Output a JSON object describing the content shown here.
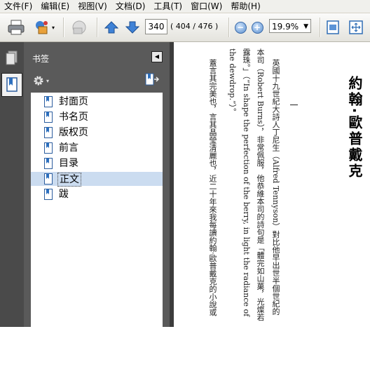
{
  "menu": [
    "文件(F)",
    "编辑(E)",
    "视图(V)",
    "文档(D)",
    "工具(T)",
    "窗口(W)",
    "帮助(H)"
  ],
  "toolbar": {
    "page_number": "340",
    "page_count": "( 404 / 476 )",
    "zoom": "19.9%"
  },
  "panel": {
    "title": "书签",
    "bookmarks": [
      "封面页",
      "书名页",
      "版权页",
      "前言",
      "目录",
      "正文",
      "跋"
    ],
    "selected_index": 5
  },
  "document": {
    "heading": "約翰‧歐普戴克",
    "section_mark": "一",
    "columns": [
      "英國十九世紀大詩人丁尼生（Alfred Tennyson）對比他早出世半個世紀的",
      "本司（Robert Burns），非常佩服，他恭維本司的詩句是「體完如山菓，光燦若",
      "露珠。」（“In shape the perfection of the berry, in light the radiance of",
      "the dewdrop.”）。",
      "蓋言其完美也，言其晶瑩清麗也，近二十年來我每讀約翰‧歐普戴克的小說或"
    ]
  }
}
